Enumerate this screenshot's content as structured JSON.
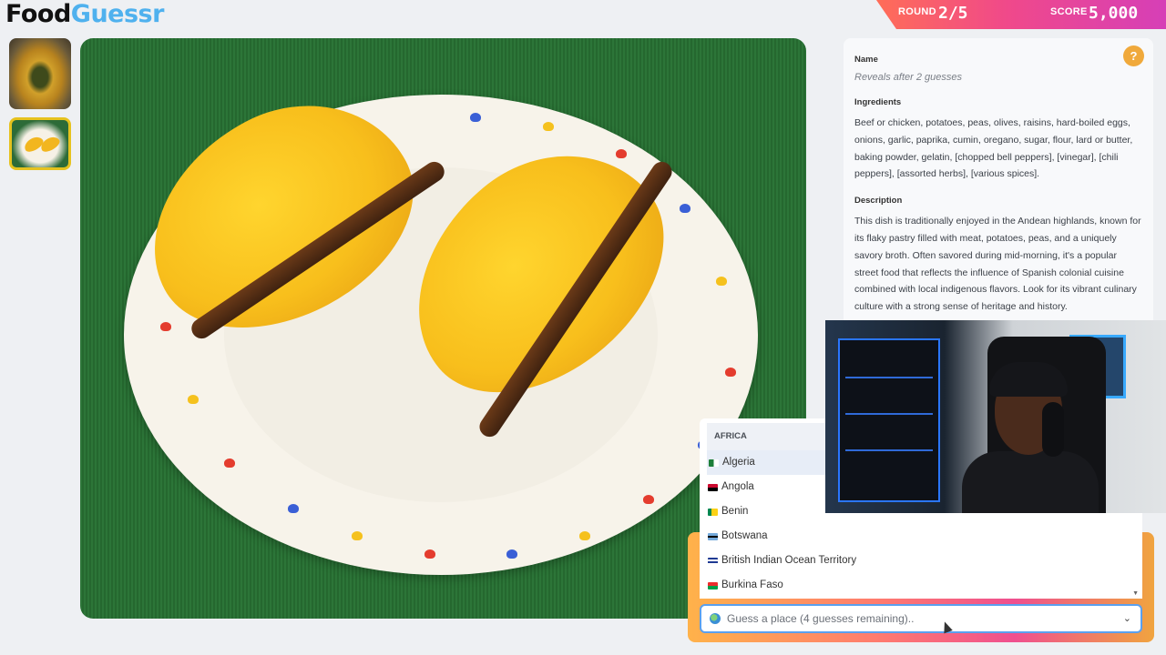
{
  "app": {
    "logo_part1": "Food",
    "logo_part2": "Guessr"
  },
  "header": {
    "round_label": "ROUND",
    "round_value": "2/5",
    "score_label": "SCORE",
    "score_value": "5,000"
  },
  "thumbnails": [
    {
      "label": "photo-1"
    },
    {
      "label": "photo-2",
      "selected": true
    }
  ],
  "info_panel": {
    "help_icon": "question-circle-icon",
    "name_heading": "Name",
    "name_placeholder": "Reveals after 2 guesses",
    "ingredients_heading": "Ingredients",
    "ingredients_text": "Beef or chicken, potatoes, peas, olives, raisins, hard-boiled eggs, onions, garlic, paprika, cumin, oregano, sugar, flour, lard or butter, baking powder, gelatin, [chopped bell peppers], [vinegar], [chili peppers], [assorted herbs], [various spices].",
    "description_heading": "Description",
    "description_text": "This dish is traditionally enjoyed in the Andean highlands, known for its flaky pastry filled with meat, potatoes, peas, and a uniquely savory broth. Often savored during mid-morning, it's a popular street food that reflects the influence of Spanish colonial cuisine combined with local indigenous flavors. Look for its vibrant culinary culture with a strong sense of heritage and history."
  },
  "dropdown": {
    "region": "AFRICA",
    "options": [
      {
        "label": "Algeria",
        "flag_colors": [
          "#1e7f3a",
          "#ffffff"
        ],
        "highlighted": true
      },
      {
        "label": "Angola",
        "flag_colors": [
          "#cc092f",
          "#000000"
        ]
      },
      {
        "label": "Benin",
        "flag_colors": [
          "#008751",
          "#fcd116",
          "#e8112d"
        ]
      },
      {
        "label": "Botswana",
        "flag_colors": [
          "#75aadb",
          "#000000"
        ]
      },
      {
        "label": "British Indian Ocean Territory",
        "flag_colors": [
          "#1f3a93",
          "#ffffff"
        ]
      },
      {
        "label": "Burkina Faso",
        "flag_colors": [
          "#ef2b2d",
          "#009e49"
        ]
      }
    ]
  },
  "guess_input": {
    "placeholder": "Guess a place (4 guesses remaining)..",
    "value": ""
  },
  "colors": {
    "accent_blue": "#4fb1ee",
    "round_gradient_start": "#ff6d57",
    "round_gradient_end": "#d63fb7",
    "help_orange": "#f0a93b"
  }
}
